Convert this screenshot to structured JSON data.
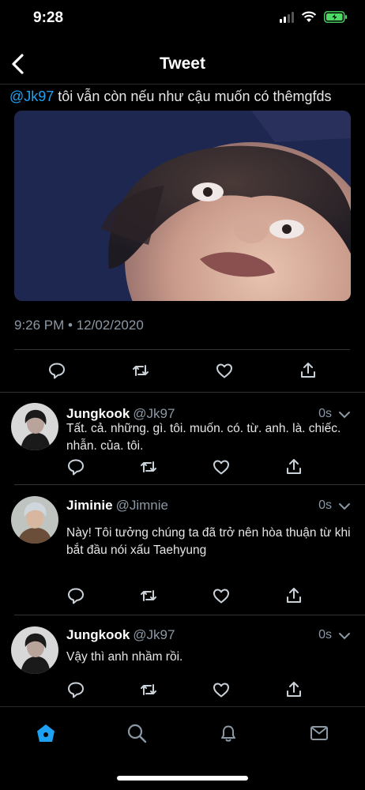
{
  "status_bar": {
    "time": "9:28"
  },
  "nav": {
    "title": "Tweet"
  },
  "tweet": {
    "mention": "@Jk97",
    "text": " tôi vẫn còn nếu như cậu muốn có thêmgfds",
    "timestamp": "9:26 PM • 12/02/2020"
  },
  "replies": [
    {
      "name": "Jungkook",
      "handle": "@Jk97",
      "time": "0s",
      "text": "Tất. cả. những. gì. tôi. muốn. có. từ. anh. là. chiếc. nhẫn. của. tôi."
    },
    {
      "name": "Jiminie",
      "handle": "@Jimnie",
      "time": "0s",
      "text": "Này! Tôi tưởng chúng ta đã trở nên hòa thuận từ khi bắt đầu nói xấu Taehyung"
    },
    {
      "name": "Jungkook",
      "handle": "@Jk97",
      "time": "0s",
      "text": "Vậy thì anh nhầm rồi."
    }
  ],
  "colors": {
    "accent": "#1da1f2",
    "muted": "#8b98a5",
    "battery": "#4cd964"
  },
  "tabs": [
    "home-icon",
    "search-icon",
    "bell-icon",
    "mail-icon"
  ]
}
